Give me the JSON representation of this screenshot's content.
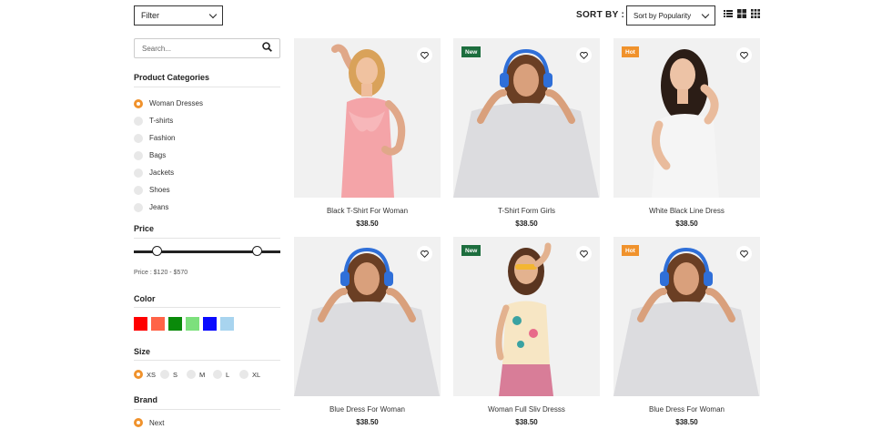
{
  "toolbar": {
    "filter_label": "Filter",
    "sort_title": "SORT BY :",
    "sort_value": "Sort by Popularity",
    "view_icons": [
      "list-view-icon",
      "grid-2-view-icon",
      "grid-3-view-icon"
    ]
  },
  "search": {
    "placeholder": "Search..."
  },
  "categories": {
    "title": "Product Categories",
    "items": [
      {
        "label": "Woman Dresses",
        "selected": true
      },
      {
        "label": "T-shirts",
        "selected": false
      },
      {
        "label": "Fashion",
        "selected": false
      },
      {
        "label": "Bags",
        "selected": false
      },
      {
        "label": "Jackets",
        "selected": false
      },
      {
        "label": "Shoes",
        "selected": false
      },
      {
        "label": "Jeans",
        "selected": false
      }
    ]
  },
  "price": {
    "title": "Price",
    "range_text": "Price :  $120 - $570",
    "min_fraction": 0.16,
    "max_fraction": 0.84
  },
  "color": {
    "title": "Color",
    "swatches": [
      "#ff0000",
      "#ff6347",
      "#0a8a0a",
      "#7de07d",
      "#0a0aff",
      "#a8d4ef"
    ]
  },
  "size": {
    "title": "Size",
    "options": [
      {
        "label": "XS",
        "selected": true
      },
      {
        "label": "S",
        "selected": false
      },
      {
        "label": "M",
        "selected": false
      },
      {
        "label": "L",
        "selected": false
      },
      {
        "label": "XL",
        "selected": false
      }
    ]
  },
  "brand": {
    "title": "Brand",
    "options": [
      {
        "label": "Next",
        "selected": true
      }
    ]
  },
  "products": [
    {
      "name": "Black T-Shirt For Woman",
      "price": "$38.50",
      "badge": ""
    },
    {
      "name": "T-Shirt Form Girls",
      "price": "$38.50",
      "badge": "New"
    },
    {
      "name": "White Black Line Dress",
      "price": "$38.50",
      "badge": "Hot"
    },
    {
      "name": "Blue Dress For Woman",
      "price": "$38.50",
      "badge": ""
    },
    {
      "name": "Woman Full Sliv Dresss",
      "price": "$38.50",
      "badge": "New"
    },
    {
      "name": "Blue Dress For Woman",
      "price": "$38.50",
      "badge": "Hot"
    }
  ]
}
